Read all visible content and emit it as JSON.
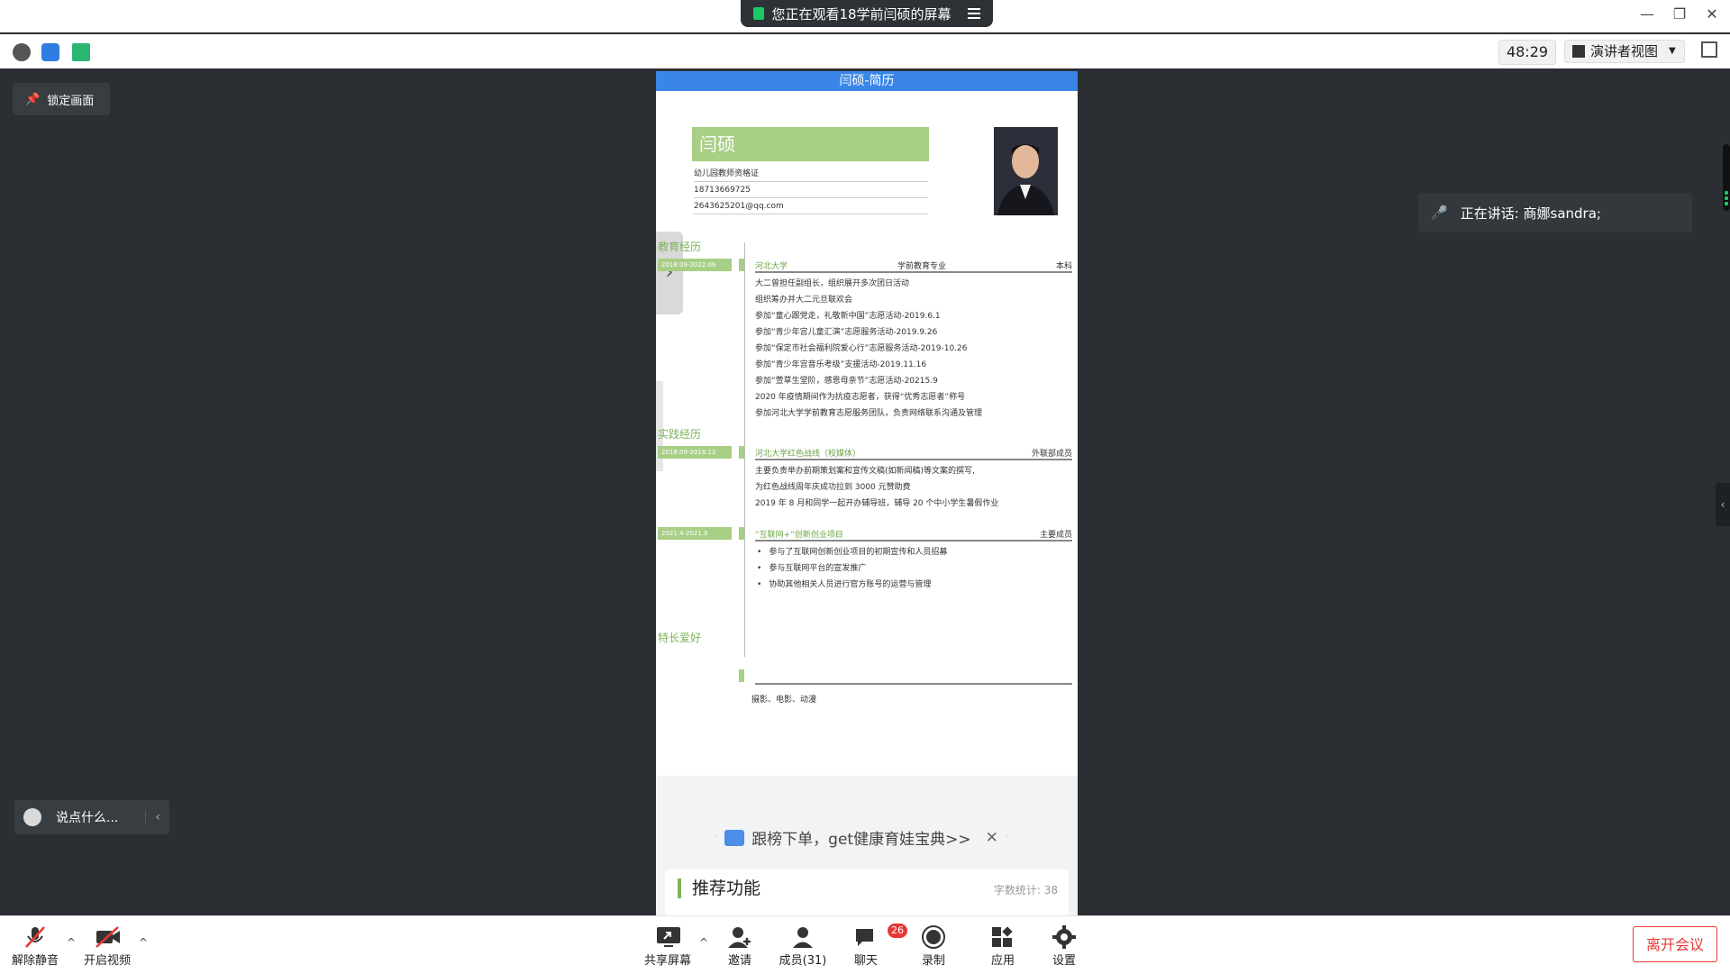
{
  "share_banner": {
    "text": "您正在观看18学前闫硕的屏幕"
  },
  "toolbar": {
    "timer": "48:29",
    "view_mode": "演讲者视图"
  },
  "stage": {
    "lock_label": "锁定画面",
    "chat_placeholder": "说点什么...",
    "speaking": "正在讲话: 商娜sandra;"
  },
  "document": {
    "header_title": "闫硕-简历",
    "name": "闫硕",
    "info": [
      "幼儿园教师资格证",
      "18713669725",
      "2643625201@qq.com"
    ],
    "sections": {
      "education": "教育经历",
      "practice": "实践经历",
      "skills": "特长爱好"
    },
    "education": {
      "date": "2018.09-2022.06",
      "school": "河北大学",
      "major": "学前教育专业",
      "degree": "本科",
      "items": [
        "大二曾担任副组长，组织展开多次团日活动",
        "组织筹办并大二元旦联欢会",
        "参加“童心跟党走，礼敬新中国”志愿活动-2019.6.1",
        "参加“青少年宫儿童汇演”志愿服务活动-2019.9.26",
        "参加“保定市社会福利院爱心行”志愿服务活动-2019-10.26",
        "参加“青少年宫音乐考级”支援活动-2019.11.16",
        "参加“萱草生堂阶，感恩母亲节”志愿活动-20215.9",
        "2020 年疫情期间作为抗疫志愿者，获得“优秀志愿者”称号",
        "参加河北大学学前教育志愿服务团队，负责网络联系沟通及管理"
      ]
    },
    "practice1": {
      "date": "2018.09-2018.12",
      "org": "河北大学红色战线（校媒体）",
      "role": "外联部成员",
      "items": [
        "主要负责举办前期策划案和宣传文稿(如新闻稿)等文案的撰写,",
        "为红色战线周年庆成功拉到 3000 元赞助费",
        "2019 年 8 月和同学一起开办辅导班，辅导 20 个中小学生暑假作业"
      ]
    },
    "practice2": {
      "date": "2021.4-2021.9",
      "org": "“互联网+”创新创业项目",
      "role": "主要成员",
      "items": [
        "参与了互联网创新创业项目的初期宣传和人员招募",
        "参与互联网平台的宣发推广",
        "协助其他相关人员进行官方账号的运营与管理"
      ]
    },
    "skills_text": "摄影、电影、动漫",
    "ad_text": "跟榜下单，get健康育娃宝典>>",
    "recommend_title": "推荐功能",
    "word_count": "字数统计: 38"
  },
  "bottom": {
    "unmute": "解除静音",
    "video": "开启视频",
    "share": "共享屏幕",
    "invite": "邀请",
    "members": "成员(31)",
    "chat": "聊天",
    "chat_badge": "26",
    "record": "录制",
    "apps": "应用",
    "settings": "设置",
    "leave": "离开会议"
  },
  "colors": {
    "accent_blue": "#3a86e8",
    "resume_green": "#a7cf85",
    "leave_red": "#e53935"
  }
}
